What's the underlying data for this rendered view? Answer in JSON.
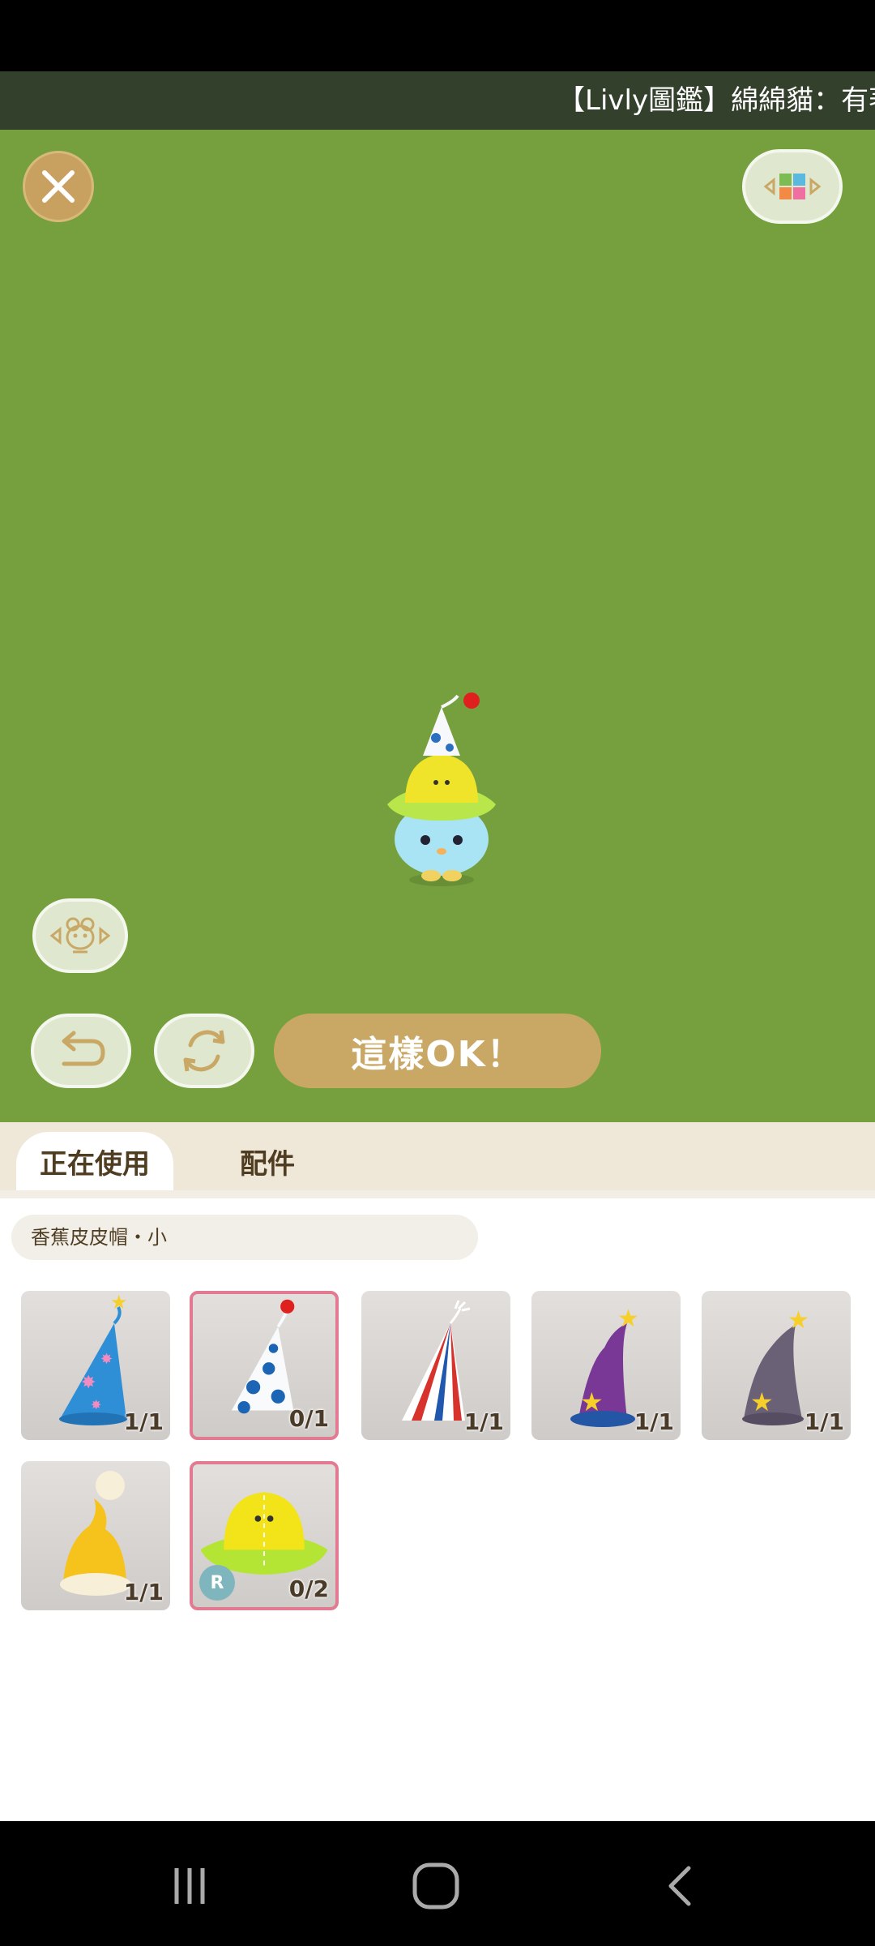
{
  "ticker": {
    "text": "【Livly圖鑑】綿綿貓：有著"
  },
  "stage": {
    "ok_label": "這樣OK！",
    "background_color": "#76a03e",
    "accent_color": "#c9a865"
  },
  "tabs": [
    {
      "label": "正在使用",
      "active": true
    },
    {
      "label": "配件",
      "active": false
    }
  ],
  "selected_item_name": "香蕉皮皮帽・小",
  "items": [
    {
      "name": "star-party-hat-icon",
      "count": "1/1",
      "selected": false,
      "rare": false
    },
    {
      "name": "polka-dot-party-hat-icon",
      "count": "0/1",
      "selected": true,
      "rare": false
    },
    {
      "name": "striped-party-hat-icon",
      "count": "1/1",
      "selected": false,
      "rare": false
    },
    {
      "name": "purple-wizard-hat-icon",
      "count": "1/1",
      "selected": false,
      "rare": false
    },
    {
      "name": "gray-wizard-hat-icon",
      "count": "1/1",
      "selected": false,
      "rare": false
    },
    {
      "name": "yellow-beanie-hat-icon",
      "count": "1/1",
      "selected": false,
      "rare": false
    },
    {
      "name": "banana-peel-hat-icon",
      "count": "0/2",
      "selected": true,
      "rare": true,
      "badge": "R"
    }
  ],
  "nav": {
    "recents": "recents-icon",
    "home": "home-icon",
    "back": "back-icon"
  }
}
